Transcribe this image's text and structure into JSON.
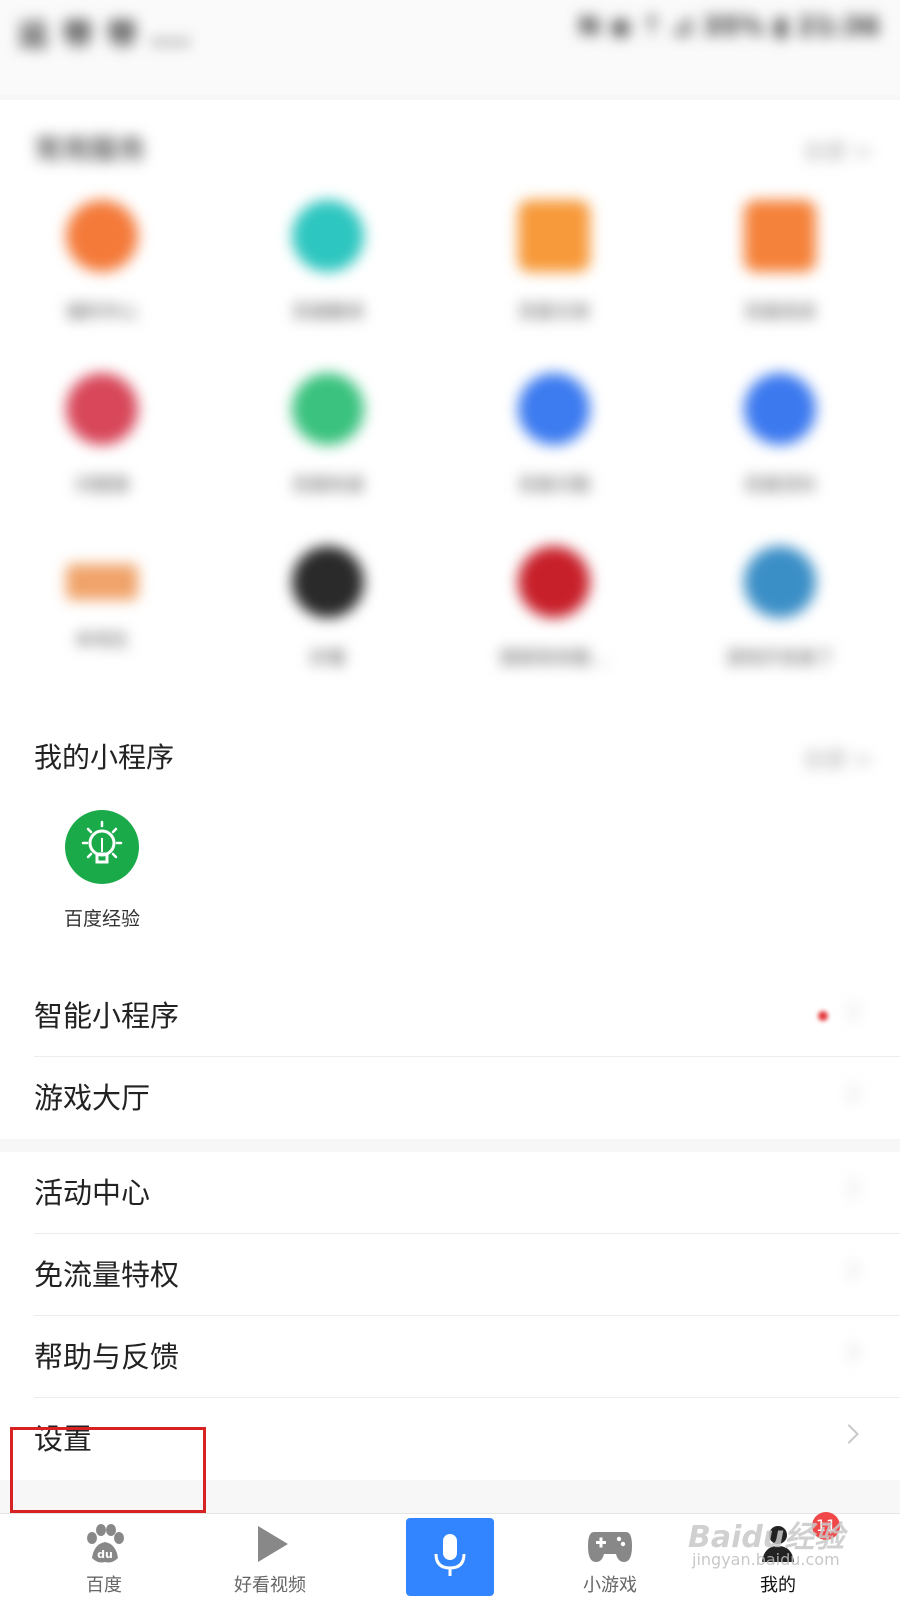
{
  "status_bar": {
    "left": "运 带 带 ...",
    "right": "N ◉ ⇡ ⊿ 35% ▮ 21:36"
  },
  "common_services": {
    "title": "常用服务",
    "more": "全部 >",
    "items": [
      {
        "label": "福利中心",
        "color": "#f47a3a"
      },
      {
        "label": "百度翻译",
        "color": "#2ec6c0"
      },
      {
        "label": "百度文库",
        "color": "#f79a3b"
      },
      {
        "label": "百度阅读",
        "color": "#f5823a"
      },
      {
        "label": "问题搜",
        "color": "#d8475a"
      },
      {
        "label": "百度知道",
        "color": "#3ac27e"
      },
      {
        "label": "百度识图",
        "color": "#3c7bf0"
      },
      {
        "label": "百度百科",
        "color": "#3c79ef"
      },
      {
        "label": "本地生",
        "color": "#f0a36a"
      },
      {
        "label": "好看",
        "color": "#2a2a2a"
      },
      {
        "label": "国家政务服…",
        "color": "#c8202a"
      },
      {
        "label": "游戏开发者了",
        "color": "#3b8fc7"
      }
    ]
  },
  "mini_programs": {
    "title": "我的小程序",
    "more": "全部 >",
    "items": [
      {
        "label": "百度经验",
        "color": "#1aaa49",
        "icon": "lightbulb-icon"
      }
    ]
  },
  "menu_group_1": [
    {
      "label": "智能小程序",
      "has_dot": true
    },
    {
      "label": "游戏大厅",
      "has_dot": false
    }
  ],
  "menu_group_2": [
    {
      "label": "活动中心"
    },
    {
      "label": "免流量特权"
    },
    {
      "label": "帮助与反馈"
    },
    {
      "label": "设置"
    }
  ],
  "tabbar": {
    "tabs": [
      {
        "label": "百度",
        "icon": "paw-icon"
      },
      {
        "label": "好看视频",
        "icon": "play-icon"
      },
      {
        "label": "",
        "icon": "microphone-icon"
      },
      {
        "label": "小游戏",
        "icon": "gamepad-icon"
      },
      {
        "label": "我的",
        "icon": "user-icon"
      }
    ],
    "badge": "11",
    "active_tab": "我的"
  },
  "watermark": {
    "line1": "Baidu经验",
    "line2": "jingyan.baidu.com"
  },
  "colors": {
    "accent": "#3385ff",
    "highlight_border": "#d62222",
    "badge": "#f04848"
  }
}
